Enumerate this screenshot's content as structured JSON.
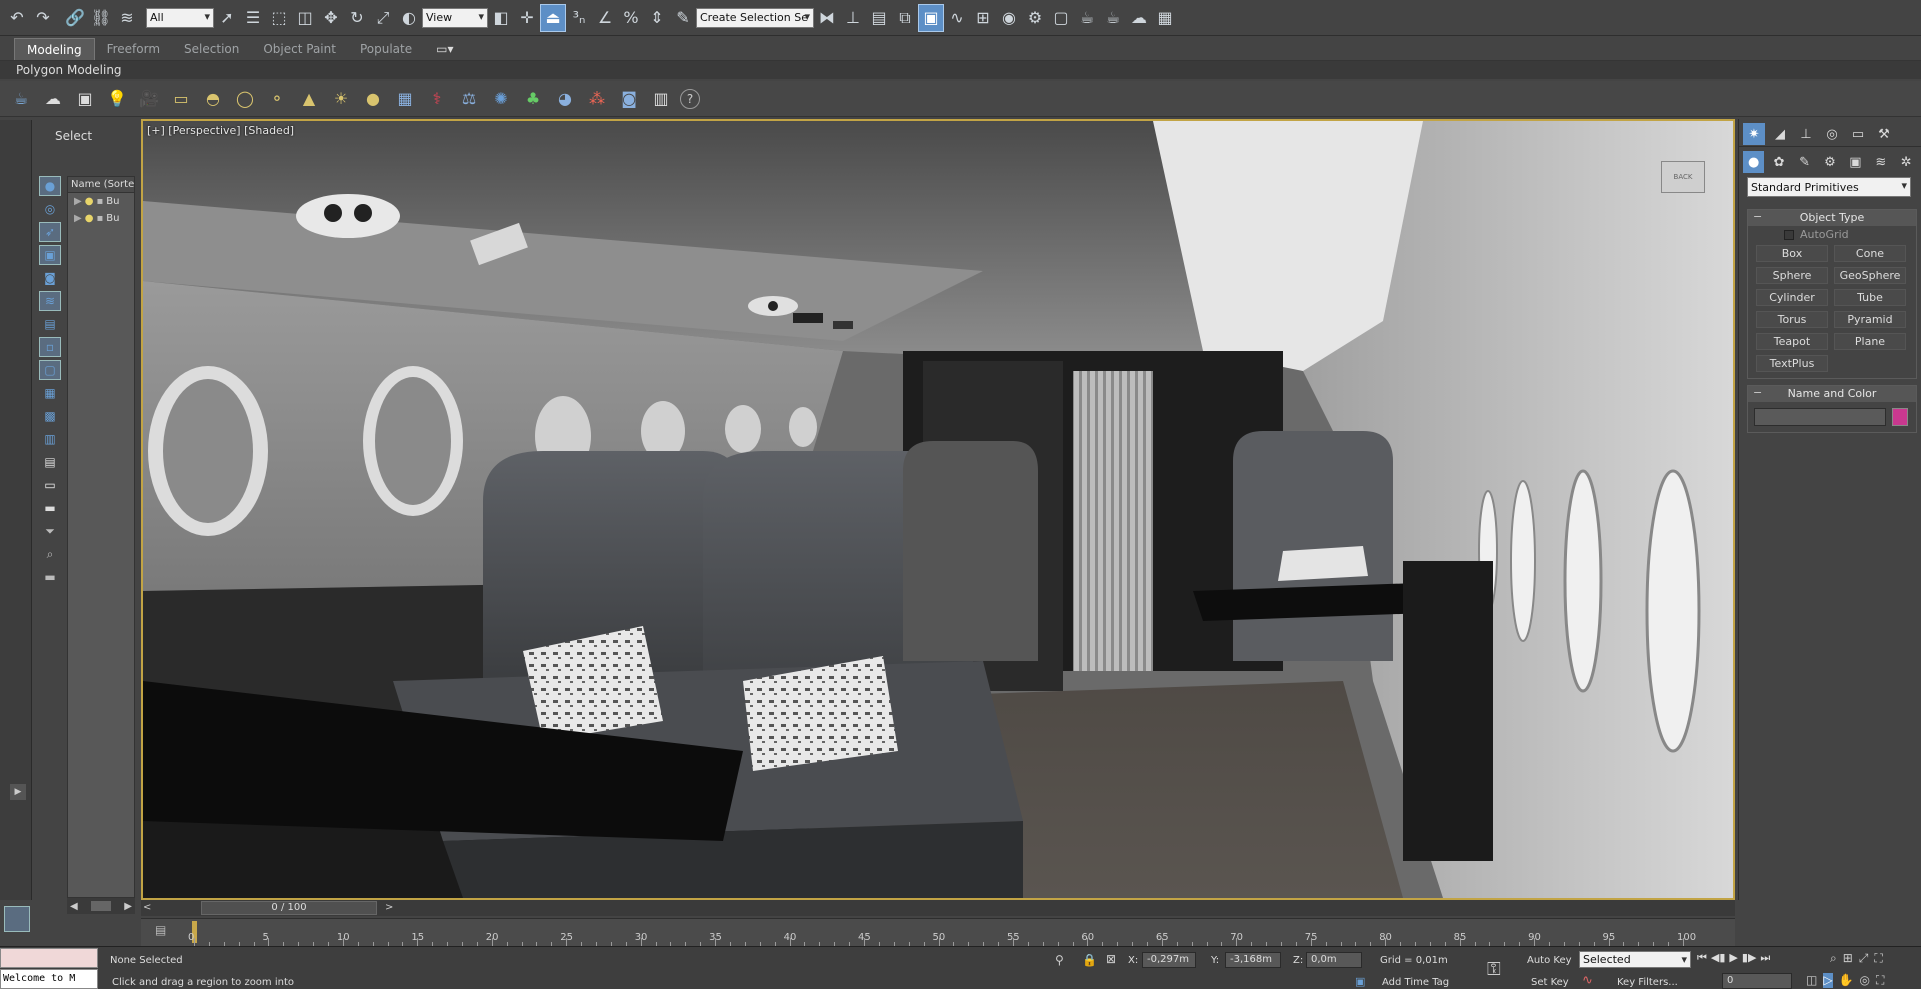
{
  "main_toolbar": {
    "selection_filter": "All",
    "ref_coord": "View",
    "named_selection_placeholder": "Create Selection Se"
  },
  "ribbon": {
    "tabs": [
      "Modeling",
      "Freeform",
      "Selection",
      "Object Paint",
      "Populate"
    ],
    "panel_label": "Polygon Modeling"
  },
  "scene_explorer": {
    "header": "Select",
    "column_header": "Name (Sorted",
    "rows": [
      "Bu",
      "Bu"
    ]
  },
  "viewport": {
    "label": "[+] [Perspective] [Shaded]",
    "viewcube_label": "BACK",
    "colors": {
      "border": "#c2a445"
    }
  },
  "command_panel": {
    "category": "Standard Primitives",
    "object_type_title": "Object Type",
    "autogrid": "AutoGrid",
    "buttons": [
      "Box",
      "Cone",
      "Sphere",
      "GeoSphere",
      "Cylinder",
      "Tube",
      "Torus",
      "Pyramid",
      "Teapot",
      "Plane",
      "TextPlus"
    ],
    "name_color_title": "Name and Color",
    "object_color": "#c9388f"
  },
  "timeline": {
    "slider_label": "0 / 100",
    "ticks": [
      "0",
      "5",
      "10",
      "15",
      "20",
      "25",
      "30",
      "35",
      "40",
      "45",
      "50",
      "55",
      "60",
      "65",
      "70",
      "75",
      "80",
      "85",
      "90",
      "95",
      "100"
    ]
  },
  "status_bar": {
    "maxscript": "Welcome to M",
    "selection": "None Selected",
    "prompt": "Click and drag a region to zoom into",
    "x_label": "X:",
    "x_value": "-0,297m",
    "y_label": "Y:",
    "y_value": "-3,168m",
    "z_label": "Z:",
    "z_value": "0,0m",
    "grid": "Grid = 0,01m",
    "add_time_tag": "Add Time Tag",
    "auto_key": "Auto Key",
    "set_key": "Set Key",
    "key_mode": "Selected",
    "key_filters": "Key Filters...",
    "frame": "0"
  }
}
